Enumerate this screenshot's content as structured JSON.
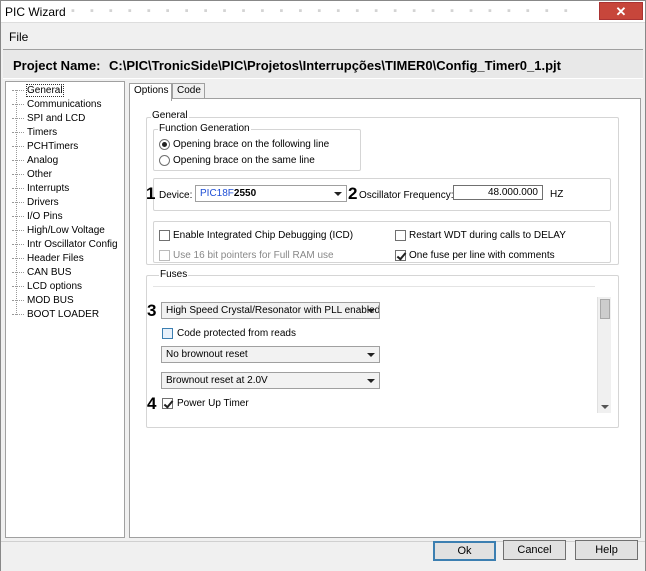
{
  "window": {
    "title": "PIC Wizard",
    "close_glyph": "✕",
    "menu_file": "File"
  },
  "project": {
    "label": "Project Name:",
    "path": "C:\\PIC\\TronicSide\\PIC\\Projetos\\Interrupções\\TIMER0\\Config_Timer0_1.pjt"
  },
  "tree": {
    "items": [
      "General",
      "Communications",
      "SPI and LCD",
      "Timers",
      "PCHTimers",
      "Analog",
      "Other",
      "Interrupts",
      "Drivers",
      "I/O Pins",
      "High/Low Voltage",
      "Intr Oscillator Config",
      "Header Files",
      "CAN BUS",
      "LCD options",
      "MOD BUS",
      "BOOT LOADER"
    ]
  },
  "tabs": {
    "options": "Options",
    "code": "Code"
  },
  "general": {
    "group_label": "General",
    "function_generation": {
      "label": "Function Generation",
      "opt1": "Opening brace on the following line",
      "opt2": "Opening brace on the same line"
    },
    "device": {
      "marker": "1",
      "label": "Device:",
      "value_prefix": "PIC18F",
      "value_suffix": "2550"
    },
    "oscillator": {
      "marker": "2",
      "label": "Oscillator Frequency:",
      "value": "48.000.000",
      "unit": "HZ"
    },
    "options": {
      "icd": "Enable Integrated Chip Debugging (ICD)",
      "restart_wdt": "Restart WDT during calls to DELAY",
      "pointers16": "Use 16 bit pointers for Full RAM use",
      "one_fuse": "One fuse per line with comments"
    }
  },
  "fuses": {
    "label": "Fuses",
    "marker3": "3",
    "marker4": "4",
    "oscillator_select": "High Speed Crystal/Resonator with PLL enabled",
    "code_protected": "Code protected from reads",
    "brownout_select": "No brownout reset",
    "brownout_level": "Brownout reset at 2.0V",
    "power_up_timer": "Power Up Timer"
  },
  "buttons": {
    "ok": "Ok",
    "cancel": "Cancel",
    "help": "Help"
  }
}
